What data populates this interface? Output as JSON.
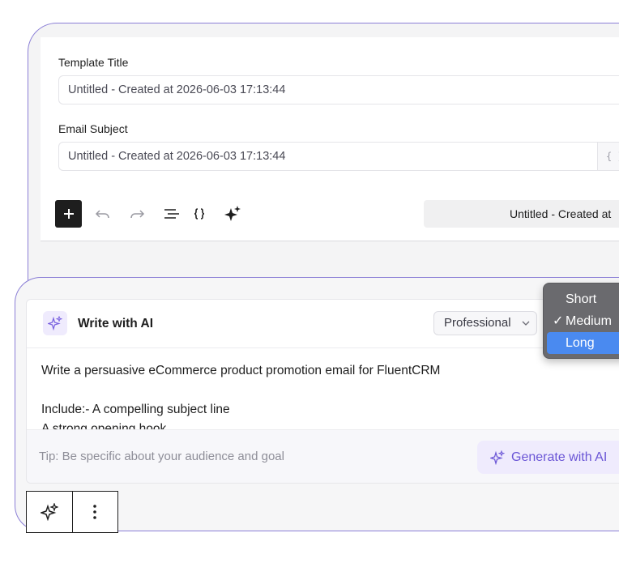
{
  "editor": {
    "template_title_label": "Template Title",
    "template_title_value": "Untitled - Created at 2026-06-03 17:13:44",
    "email_subject_label": "Email Subject",
    "email_subject_value": "Untitled - Created at 2026-06-03 17:13:44",
    "merge_tag_glyph": "{ }",
    "preview_title": "Untitled - Created at"
  },
  "ai": {
    "title": "Write with AI",
    "tone": "Professional",
    "prompt": "Write a persuasive eCommerce product promotion email for FluentCRM\n\nInclude:- A compelling subject line\nA strong opening hook",
    "tip": "Tip: Be specific about your audience and goal",
    "generate_label": "Generate with AI"
  },
  "length_menu": {
    "options": [
      "Short",
      "Medium",
      "Long"
    ],
    "checked": "Medium",
    "highlighted": "Long",
    "check_glyph": "✓"
  },
  "colors": {
    "accent": "#6b56d6",
    "accent_soft": "#efebfd",
    "frame_border": "#8b7fd6",
    "menu_highlight": "#4a8af0"
  }
}
